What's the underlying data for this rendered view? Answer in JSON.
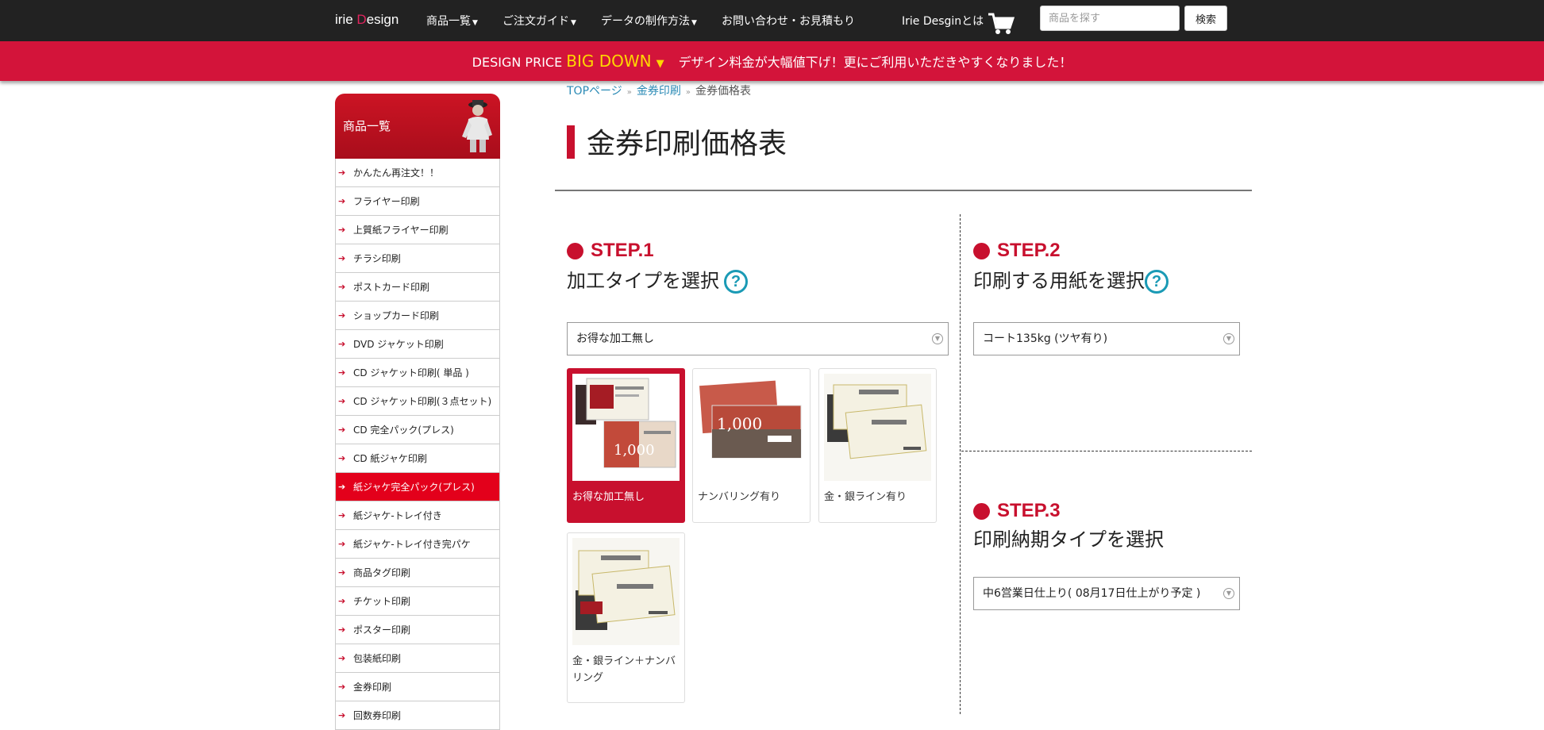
{
  "header": {
    "logo_pre": "irie ",
    "logo_d": "D",
    "logo_post": "esign",
    "nav": [
      {
        "label": "商品一覧"
      },
      {
        "label": "ご注文ガイド"
      },
      {
        "label": "データの制作方法"
      },
      {
        "label": "お問い合わせ・お見積もり"
      },
      {
        "label": "Irie Desginとは"
      }
    ],
    "search_placeholder": "商品を探す",
    "search_button": "検索"
  },
  "banner": {
    "pre": "DESIGN PRICE ",
    "big": "BIG DOWN",
    "text": "デザイン料金が大幅値下げ！更にご利用いただきやすくなりました！"
  },
  "sidebar": {
    "heading": "商品一覧",
    "items": [
      "かんたん再注文！！",
      "フライヤー印刷",
      "上質紙フライヤー印刷",
      "チラシ印刷",
      "ポストカード印刷",
      "ショップカード印刷",
      "DVD ジャケット印刷",
      "CD ジャケット印刷( 単品 )",
      "CD ジャケット印刷(３点セット)",
      "CD 完全パック(プレス)",
      "CD 紙ジャケ印刷",
      "紙ジャケ完全パック(プレス)",
      "紙ジャケ-トレイ付き",
      "紙ジャケ-トレイ付き完パケ",
      "商品タグ印刷",
      "チケット印刷",
      "ポスター印刷",
      "包装紙印刷",
      "金券印刷",
      "回数券印刷"
    ]
  },
  "breadcrumb": {
    "top": "TOPページ",
    "mid": "金券印刷",
    "current": "金券価格表"
  },
  "page_title": "金券印刷価格表",
  "step1": {
    "label": "STEP.1",
    "title": "加工タイプを選択",
    "help": "?",
    "selected": "お得な加工無し",
    "cards": [
      "お得な加工無し",
      "ナンバリング有り",
      "金・銀ライン有り",
      "金・銀ライン＋ナンバリング"
    ]
  },
  "step2": {
    "label": "STEP.2",
    "title": "印刷する用紙を選択",
    "help": "?",
    "selected": "コート135kg (ツヤ有り)"
  },
  "step3": {
    "label": "STEP.3",
    "title": "印刷納期タイプを選択",
    "selected": "中6営業日仕上り( 08月17日仕上がり予定 )"
  },
  "colors": {
    "accent": "#c8102e",
    "banner": "#d3143a",
    "link": "#2a8ab5",
    "help": "#1a9ab5"
  }
}
